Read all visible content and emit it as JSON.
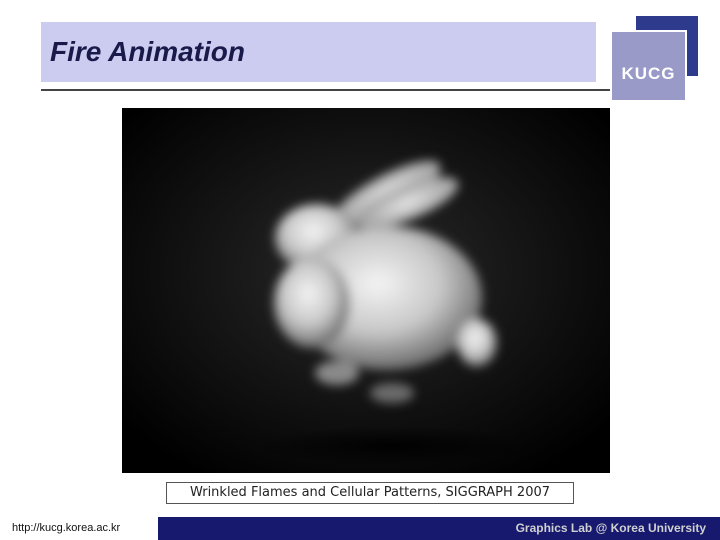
{
  "slide": {
    "title": "Fire Animation",
    "logo_text": "KUCG",
    "caption": "Wrinkled Flames and Cellular Patterns, SIGGRAPH 2007"
  },
  "footer": {
    "url": "http://kucg.korea.ac.kr",
    "credit": "Graphics Lab @ Korea University"
  },
  "colors": {
    "title_bar": "#ccccf0",
    "footer": "#16196e",
    "logo_dark": "#2e3a8c",
    "logo_light": "#9a9ac8"
  }
}
